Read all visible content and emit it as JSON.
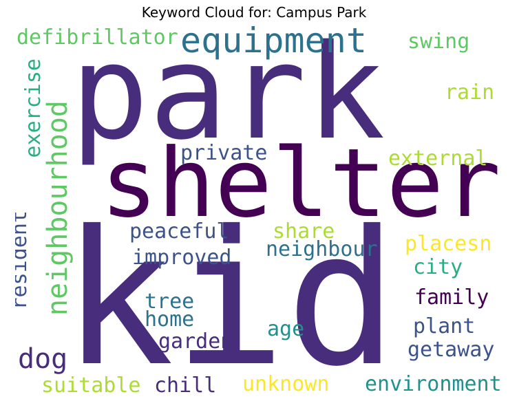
{
  "title": "Keyword Cloud for: Campus Park",
  "palette": {
    "deep_purple": "#440154",
    "indigo": "#472d7b",
    "slate_blue": "#3b528b",
    "steel": "#2c728e",
    "teal": "#21918c",
    "green_teal": "#28ae80",
    "green": "#5ec962",
    "lime": "#addc30",
    "yellow": "#fde725"
  },
  "words": {
    "park": "park",
    "shelter": "shelter",
    "kid": "kid",
    "equipment": "equipment",
    "defibrillator": "defibrillator",
    "swing": "swing",
    "exercise": "exercise",
    "neighbourhood": "neighbourhood",
    "rain": "rain",
    "private": "private",
    "external": "external",
    "resident": "resident",
    "peaceful": "peaceful",
    "share": "share",
    "placesn": "placesn",
    "neighbour": "neighbour",
    "improved": "improved",
    "city": "city",
    "tree": "tree",
    "family": "family",
    "home": "home",
    "age": "age",
    "plant": "plant",
    "garden": "garden",
    "dog": "dog",
    "getaway": "getaway",
    "suitable": "suitable",
    "chill": "chill",
    "unknown": "unknown",
    "environment": "environment"
  }
}
